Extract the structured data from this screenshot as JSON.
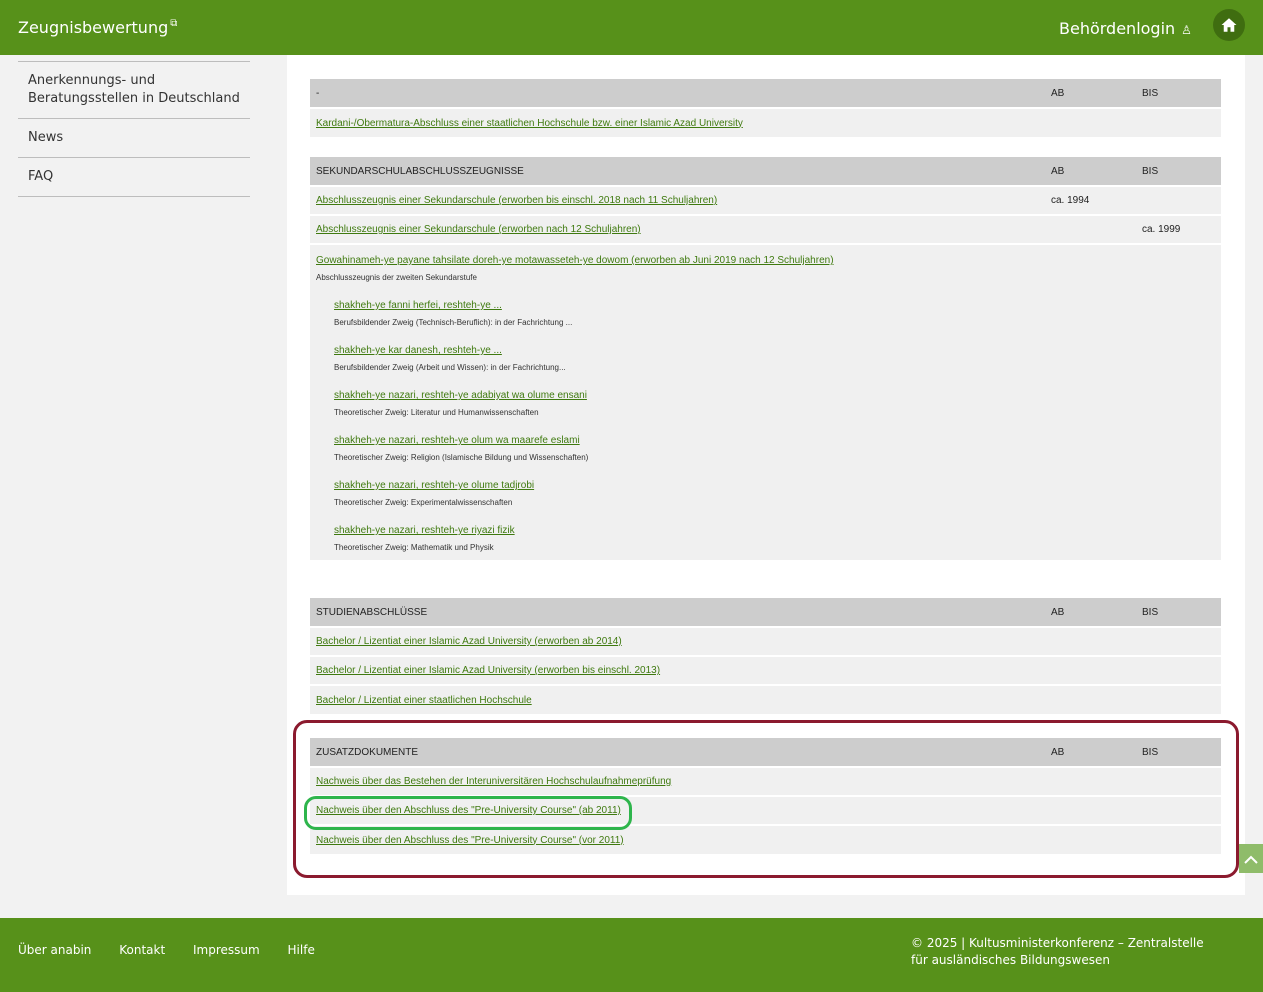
{
  "header": {
    "brand": "Zeugnisbewertung",
    "login": "Behördenlogin"
  },
  "sidebar": {
    "items": [
      {
        "label": "Anerkennungs- und Beratungsstellen in Deutschland"
      },
      {
        "label": "News"
      },
      {
        "label": "FAQ"
      }
    ]
  },
  "sections": {
    "s0": {
      "header": "-",
      "ab": "AB",
      "bis": "BIS",
      "rows": [
        {
          "label": "Kardani-/Obermatura-Abschluss einer staatlichen Hochschule bzw. einer Islamic Azad University",
          "ab": "",
          "bis": ""
        }
      ]
    },
    "s1": {
      "header": "SEKUNDARSCHULABSCHLUSSZEUGNISSE",
      "ab": "AB",
      "bis": "BIS",
      "rows": [
        {
          "label": "Abschlusszeugnis einer Sekundarschule (erworben bis einschl. 2018 nach 11 Schuljahren)",
          "ab": "ca. 1994",
          "bis": ""
        },
        {
          "label": "Abschlusszeugnis einer Sekundarschule (erworben nach 12 Schuljahren)",
          "ab": "",
          "bis": "ca. 1999"
        }
      ],
      "group": {
        "label": "Gowahinameh-ye payane tahsilate doreh-ye motawasseteh-ye dowom (erworben ab Juni 2019 nach 12 Schuljahren)",
        "desc": "Abschlusszeugnis der zweiten Sekundarstufe",
        "subs": [
          {
            "label": "shakheh-ye fanni herfei, reshteh-ye ...",
            "desc": "Berufsbildender Zweig (Technisch-Beruflich): in der Fachrichtung ..."
          },
          {
            "label": "shakheh-ye kar danesh, reshteh-ye ...",
            "desc": "Berufsbildender Zweig (Arbeit und Wissen): in der Fachrichtung..."
          },
          {
            "label": "shakheh-ye nazari, reshteh-ye adabiyat wa olume ensani",
            "desc": "Theoretischer Zweig: Literatur und Humanwissenschaften"
          },
          {
            "label": "shakheh-ye nazari, reshteh-ye olum wa maarefe eslami",
            "desc": "Theoretischer Zweig: Religion (Islamische Bildung und Wissenschaften)"
          },
          {
            "label": "shakheh-ye nazari, reshteh-ye olume tadjrobi",
            "desc": "Theoretischer Zweig: Experimentalwissenschaften"
          },
          {
            "label": "shakheh-ye nazari, reshteh-ye riyazi fizik",
            "desc": "Theoretischer Zweig: Mathematik und Physik"
          }
        ]
      }
    },
    "s2": {
      "header": "STUDIENABSCHLÜSSE",
      "ab": "AB",
      "bis": "BIS",
      "rows": [
        {
          "label": "Bachelor / Lizentiat einer Islamic Azad University (erworben ab 2014)",
          "ab": "",
          "bis": ""
        },
        {
          "label": "Bachelor / Lizentiat einer Islamic Azad University (erworben bis einschl. 2013)",
          "ab": "",
          "bis": ""
        },
        {
          "label": "Bachelor / Lizentiat einer staatlichen Hochschule",
          "ab": "",
          "bis": ""
        }
      ]
    },
    "s3": {
      "header": "ZUSATZDOKUMENTE",
      "ab": "AB",
      "bis": "BIS",
      "rows": [
        {
          "label": "Nachweis über das Bestehen der Interuniversitären Hochschulaufnahmeprüfung",
          "ab": "",
          "bis": ""
        },
        {
          "label": "Nachweis über den Abschluss des \"Pre-University Course\" (ab 2011)",
          "ab": "",
          "bis": ""
        },
        {
          "label": "Nachweis über den Abschluss des \"Pre-University Course\" (vor 2011)",
          "ab": "",
          "bis": ""
        }
      ]
    }
  },
  "footer": {
    "links": [
      "Über anabin",
      "Kontakt",
      "Impressum",
      "Hilfe"
    ],
    "copyright": "© 2025 | Kultusministerkonferenz – Zentralstelle für ausländisches Bildungswesen"
  },
  "colors": {
    "brand_green": "#57911a",
    "link_green": "#3f7a0f",
    "highlight_red": "#8b1a2e",
    "highlight_green": "#2eb54c"
  },
  "icons": {
    "external": "external-link-icon",
    "user": "user-icon",
    "home": "home-icon",
    "scroll": "chevron-up-icon"
  }
}
